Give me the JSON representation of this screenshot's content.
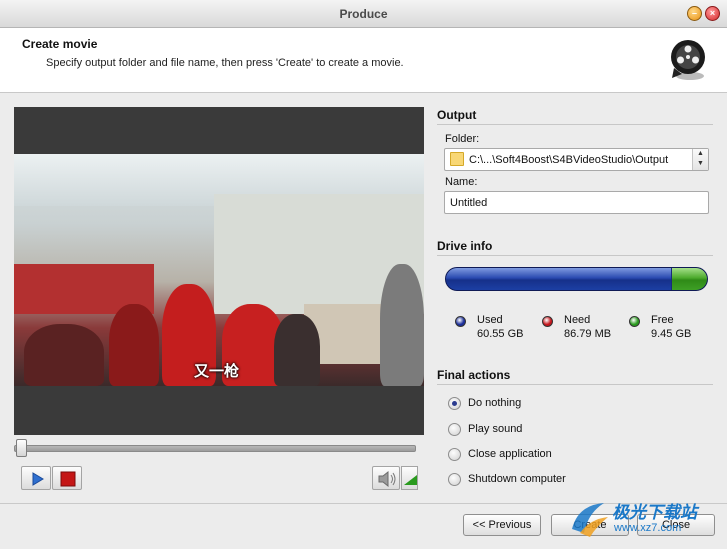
{
  "window": {
    "title": "Produce"
  },
  "header": {
    "title": "Create movie",
    "subtitle": "Specify output folder and file name, then press 'Create' to create a movie."
  },
  "preview": {
    "subtitle_text": "又一枪",
    "seek_position": 0.0
  },
  "output": {
    "section_title": "Output",
    "folder_label": "Folder:",
    "folder_value": "C:\\...\\Soft4Boost\\S4BVideoStudio\\Output",
    "name_label": "Name:",
    "name_value": "Untitled"
  },
  "drive_info": {
    "section_title": "Drive info",
    "used_fraction": 0.862,
    "free_fraction": 0.135,
    "legend": [
      {
        "name": "Used",
        "value": "60.55 GB",
        "color": "#1c2f9a"
      },
      {
        "name": "Need",
        "value": "86.79 MB",
        "color": "#c4161c"
      },
      {
        "name": "Free",
        "value": "9.45 GB",
        "color": "#2a9a1e"
      }
    ]
  },
  "final_actions": {
    "section_title": "Final actions",
    "options": [
      {
        "label": "Do nothing",
        "checked": true
      },
      {
        "label": "Play sound",
        "checked": false
      },
      {
        "label": "Close application",
        "checked": false
      },
      {
        "label": "Shutdown computer",
        "checked": false
      }
    ]
  },
  "buttons": {
    "previous": "<< Previous",
    "create": "Create",
    "close": "Close"
  },
  "watermark": {
    "brand": "极光下载站",
    "url": "www.xz7.com"
  },
  "icons": {
    "minimize": "minimize-icon",
    "close": "close-icon",
    "film": "film-reel-icon",
    "play": "play-icon",
    "stop": "stop-icon",
    "volume": "speaker-icon",
    "folder": "folder-icon"
  }
}
